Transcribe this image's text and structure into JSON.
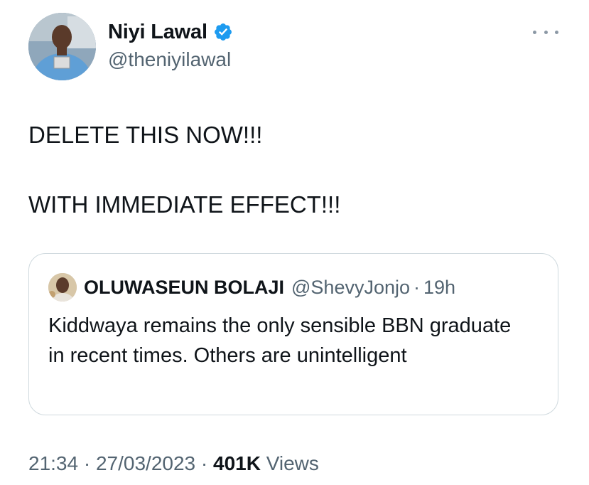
{
  "author": {
    "display_name": "Niyi Lawal",
    "handle": "@theniyilawal",
    "verified": true,
    "verified_color": "#1d9bf0"
  },
  "menu_icon": "more-horizontal-icon",
  "tweet": {
    "lines": [
      "DELETE THIS NOW!!!",
      "WITH IMMEDIATE EFFECT!!!"
    ]
  },
  "quoted_tweet": {
    "display_name": "OLUWASEUN BOLAJI",
    "handle": "@ShevyJonjo",
    "separator": "·",
    "time": "19h",
    "text": "Kiddwaya remains the only sensible BBN graduate in recent times. Others are unintelligent"
  },
  "meta": {
    "time": "21:34",
    "separator": "·",
    "date": "27/03/2023",
    "views_count": "401K",
    "views_label": "Views"
  },
  "colors": {
    "text_primary": "#0f1419",
    "text_secondary": "#536471",
    "border": "#cfd9de"
  }
}
